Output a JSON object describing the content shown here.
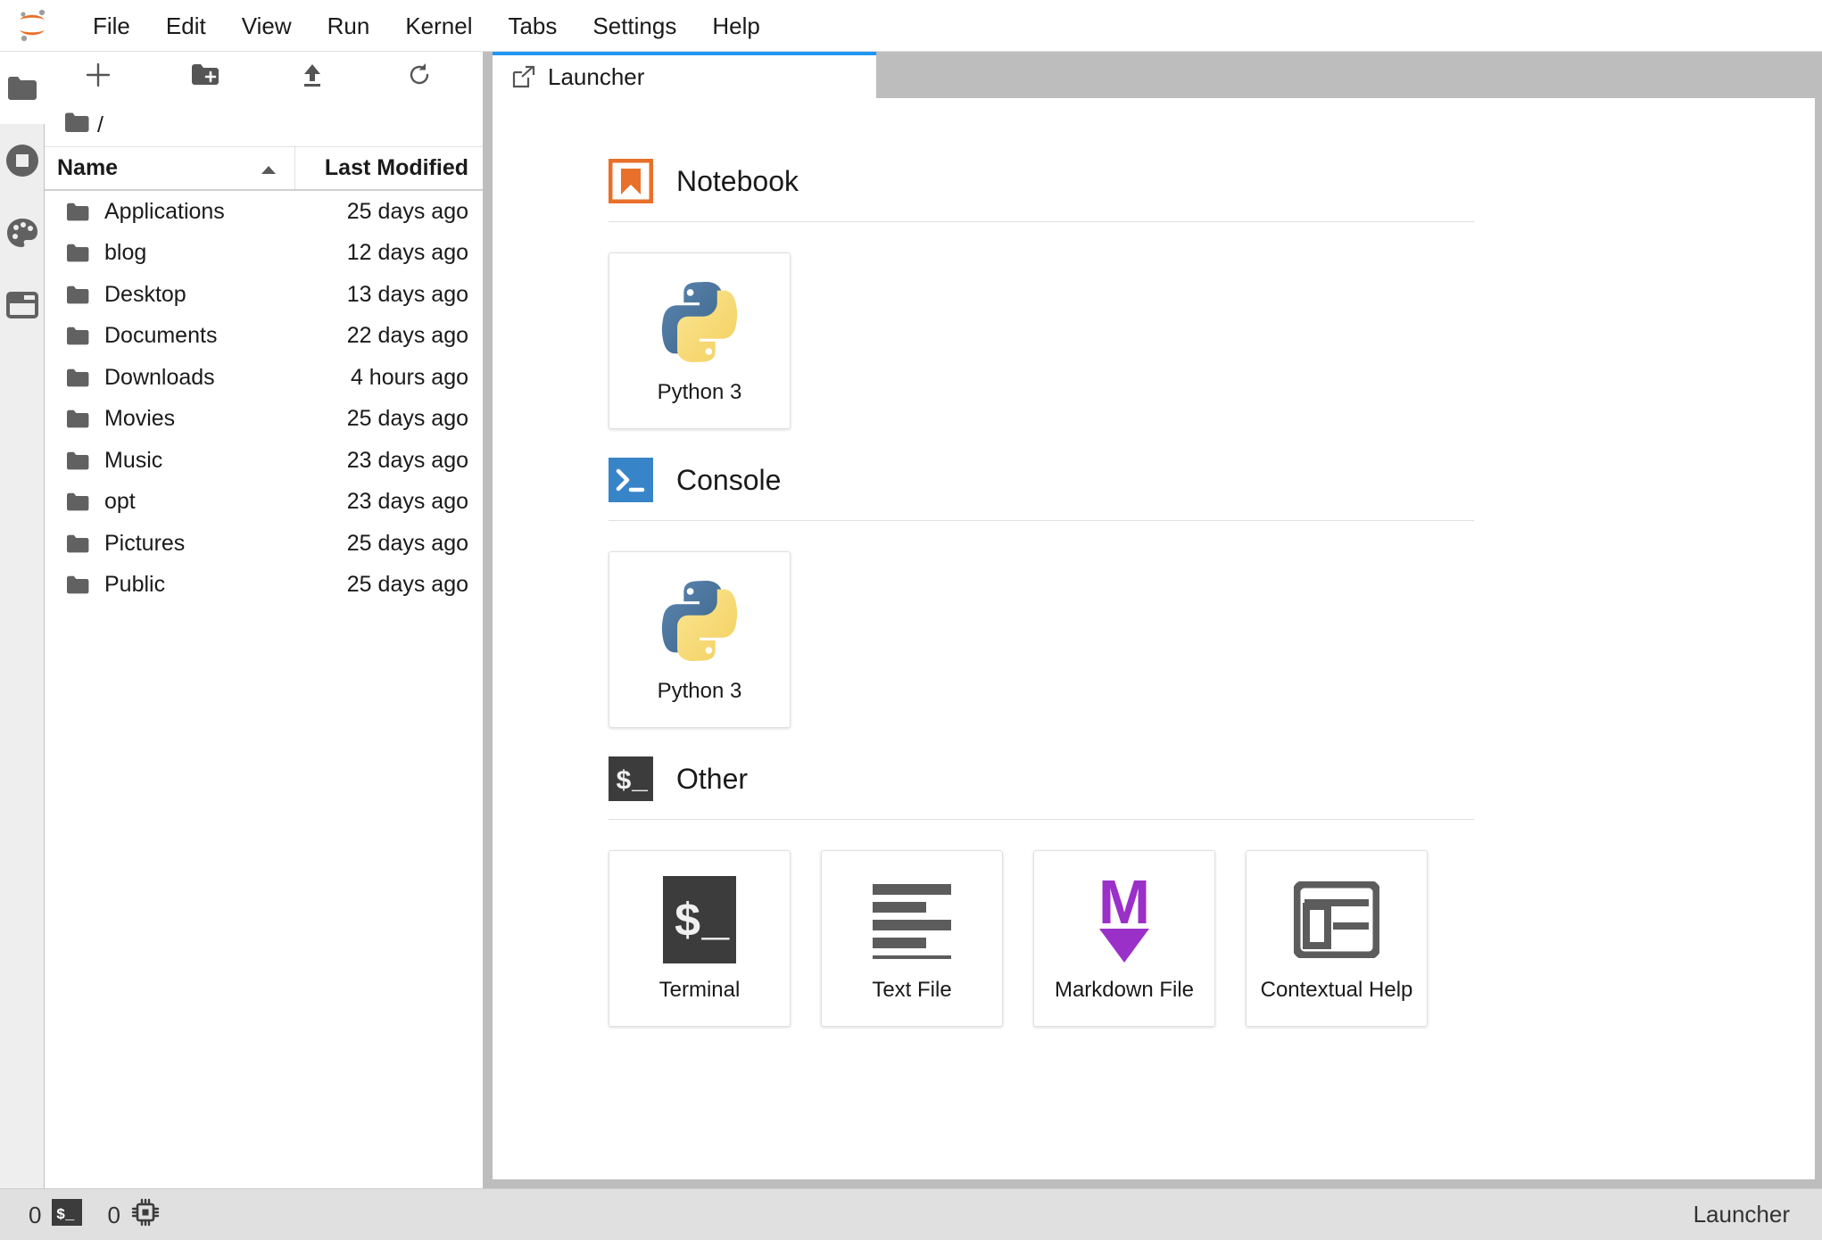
{
  "app": {
    "logo_name": "jupyterlab-logo",
    "accent_blue": "#2196f3",
    "orange": "#e8702a",
    "python_blue": "#4a6f94",
    "python_yellow": "#f8dc75",
    "markdown_purple": "#9b30c9"
  },
  "menubar": {
    "items": [
      {
        "label": "File"
      },
      {
        "label": "Edit"
      },
      {
        "label": "View"
      },
      {
        "label": "Run"
      },
      {
        "label": "Kernel"
      },
      {
        "label": "Tabs"
      },
      {
        "label": "Settings"
      },
      {
        "label": "Help"
      }
    ]
  },
  "sidebar": {
    "items": [
      {
        "icon": "folder-icon",
        "name": "file-browser",
        "active": true
      },
      {
        "icon": "running-sessions-icon",
        "name": "running-terminals-kernels",
        "active": false
      },
      {
        "icon": "palette-icon",
        "name": "command-palette",
        "active": false
      },
      {
        "icon": "tabs-icon",
        "name": "open-tabs",
        "active": false
      }
    ]
  },
  "filebrowser": {
    "toolbar": [
      {
        "name": "new-launcher-button",
        "icon": "plus-icon"
      },
      {
        "name": "new-folder-button",
        "icon": "new-folder-icon"
      },
      {
        "name": "upload-button",
        "icon": "upload-icon"
      },
      {
        "name": "refresh-button",
        "icon": "refresh-icon"
      }
    ],
    "breadcrumb": {
      "root_label": "/"
    },
    "columns": [
      {
        "label": "Name",
        "sort": "ascending"
      },
      {
        "label": "Last Modified"
      }
    ],
    "rows": [
      {
        "name": "Applications",
        "modified": "25 days ago"
      },
      {
        "name": "blog",
        "modified": "12 days ago"
      },
      {
        "name": "Desktop",
        "modified": "13 days ago"
      },
      {
        "name": "Documents",
        "modified": "22 days ago"
      },
      {
        "name": "Downloads",
        "modified": "4 hours ago"
      },
      {
        "name": "Movies",
        "modified": "25 days ago"
      },
      {
        "name": "Music",
        "modified": "23 days ago"
      },
      {
        "name": "opt",
        "modified": "23 days ago"
      },
      {
        "name": "Pictures",
        "modified": "25 days ago"
      },
      {
        "name": "Public",
        "modified": "25 days ago"
      }
    ]
  },
  "dock": {
    "tabs": [
      {
        "label": "Launcher",
        "icon": "launcher-icon",
        "active": true
      }
    ]
  },
  "launcher": {
    "sections": [
      {
        "title": "Notebook",
        "icon": "notebook-icon",
        "cards": [
          {
            "label": "Python 3",
            "icon": "python-icon"
          }
        ]
      },
      {
        "title": "Console",
        "icon": "console-icon",
        "cards": [
          {
            "label": "Python 3",
            "icon": "python-icon"
          }
        ]
      },
      {
        "title": "Other",
        "icon": "terminal-icon",
        "cards": [
          {
            "label": "Terminal",
            "icon": "terminal-icon"
          },
          {
            "label": "Text File",
            "icon": "text-file-icon"
          },
          {
            "label": "Markdown File",
            "icon": "markdown-icon"
          },
          {
            "label": "Contextual Help",
            "icon": "contextual-help-icon"
          }
        ]
      }
    ]
  },
  "statusbar": {
    "terminals_count": "0",
    "kernels_count": "0",
    "active_label": "Launcher"
  }
}
